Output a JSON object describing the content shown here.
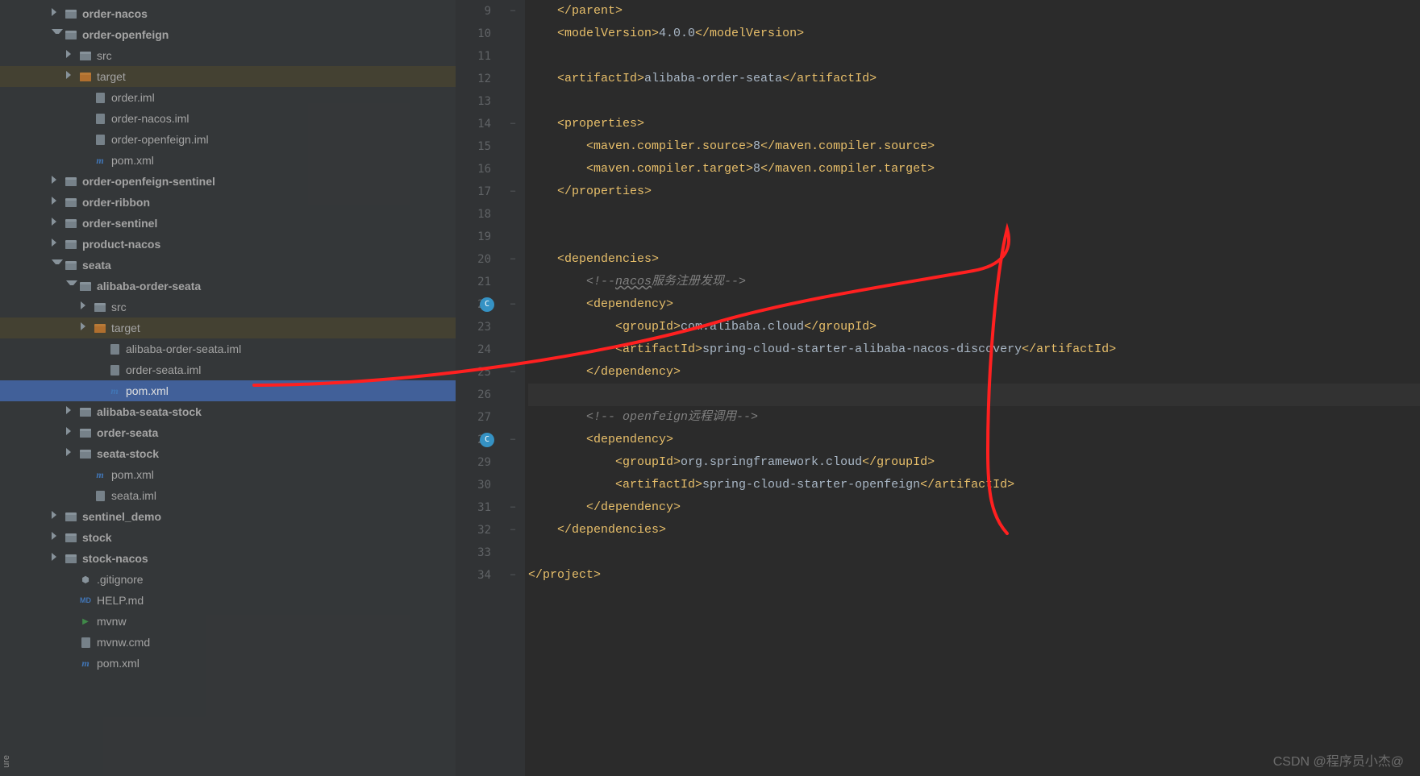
{
  "watermark": "CSDN @程序员小杰@",
  "sideLabel": "ure",
  "tree": [
    {
      "depth": 3,
      "arrow": "right",
      "icon": "folder",
      "label": "order-nacos",
      "bold": true
    },
    {
      "depth": 3,
      "arrow": "down",
      "icon": "folder",
      "label": "order-openfeign",
      "bold": true
    },
    {
      "depth": 4,
      "arrow": "right",
      "icon": "folder",
      "label": "src"
    },
    {
      "depth": 4,
      "arrow": "right",
      "icon": "folder-orange",
      "label": "target",
      "hl": true
    },
    {
      "depth": 5,
      "arrow": "none",
      "icon": "file",
      "label": "order.iml"
    },
    {
      "depth": 5,
      "arrow": "none",
      "icon": "file",
      "label": "order-nacos.iml"
    },
    {
      "depth": 5,
      "arrow": "none",
      "icon": "file",
      "label": "order-openfeign.iml"
    },
    {
      "depth": 5,
      "arrow": "none",
      "icon": "m",
      "label": "pom.xml"
    },
    {
      "depth": 3,
      "arrow": "right",
      "icon": "folder",
      "label": "order-openfeign-sentinel",
      "bold": true
    },
    {
      "depth": 3,
      "arrow": "right",
      "icon": "folder",
      "label": "order-ribbon",
      "bold": true
    },
    {
      "depth": 3,
      "arrow": "right",
      "icon": "folder",
      "label": "order-sentinel",
      "bold": true
    },
    {
      "depth": 3,
      "arrow": "right",
      "icon": "folder",
      "label": "product-nacos",
      "bold": true
    },
    {
      "depth": 3,
      "arrow": "down",
      "icon": "folder",
      "label": "seata",
      "bold": true
    },
    {
      "depth": 4,
      "arrow": "down",
      "icon": "folder",
      "label": "alibaba-order-seata",
      "bold": true
    },
    {
      "depth": 5,
      "arrow": "right",
      "icon": "folder",
      "label": "src"
    },
    {
      "depth": 5,
      "arrow": "right",
      "icon": "folder-orange",
      "label": "target",
      "hl": true
    },
    {
      "depth": 6,
      "arrow": "none",
      "icon": "file",
      "label": "alibaba-order-seata.iml"
    },
    {
      "depth": 6,
      "arrow": "none",
      "icon": "file",
      "label": "order-seata.iml"
    },
    {
      "depth": 6,
      "arrow": "none",
      "icon": "m",
      "label": "pom.xml",
      "sel": true
    },
    {
      "depth": 4,
      "arrow": "right",
      "icon": "folder",
      "label": "alibaba-seata-stock",
      "bold": true
    },
    {
      "depth": 4,
      "arrow": "right",
      "icon": "folder",
      "label": "order-seata",
      "bold": true
    },
    {
      "depth": 4,
      "arrow": "right",
      "icon": "folder",
      "label": "seata-stock",
      "bold": true
    },
    {
      "depth": 5,
      "arrow": "none",
      "icon": "m",
      "label": "pom.xml"
    },
    {
      "depth": 5,
      "arrow": "none",
      "icon": "file",
      "label": "seata.iml"
    },
    {
      "depth": 3,
      "arrow": "right",
      "icon": "folder",
      "label": "sentinel_demo",
      "bold": true
    },
    {
      "depth": 3,
      "arrow": "right",
      "icon": "folder",
      "label": "stock",
      "bold": true
    },
    {
      "depth": 3,
      "arrow": "right",
      "icon": "folder",
      "label": "stock-nacos",
      "bold": true
    },
    {
      "depth": 4,
      "arrow": "none",
      "icon": "git",
      "label": ".gitignore"
    },
    {
      "depth": 4,
      "arrow": "none",
      "icon": "md",
      "label": "HELP.md"
    },
    {
      "depth": 4,
      "arrow": "none",
      "icon": "play",
      "label": "mvnw"
    },
    {
      "depth": 4,
      "arrow": "none",
      "icon": "file",
      "label": "mvnw.cmd"
    },
    {
      "depth": 4,
      "arrow": "none",
      "icon": "m",
      "label": "pom.xml"
    }
  ],
  "lineNumbers": [
    "9",
    "10",
    "11",
    "12",
    "13",
    "14",
    "15",
    "16",
    "17",
    "18",
    "19",
    "20",
    "21",
    "22",
    "23",
    "24",
    "25",
    "26",
    "27",
    "28",
    "29",
    "30",
    "31",
    "32",
    "33",
    "34"
  ],
  "gutterMarks": {
    "22": "c",
    "28": "c"
  },
  "foldMarks": {
    "9": "⊖",
    "14": "⊖",
    "17": "⊖",
    "20": "⊖",
    "22": "⊖",
    "25": "⊖",
    "28": "⊖",
    "31": "⊖",
    "32": "⊖",
    "34": "⊖"
  },
  "code": {
    "9": [
      {
        "c": "t-tag",
        "t": "    </parent>"
      }
    ],
    "10": [
      {
        "c": "t-tag",
        "t": "    <modelVersion>"
      },
      {
        "c": "t-text",
        "t": "4.0.0"
      },
      {
        "c": "t-tag",
        "t": "</modelVersion>"
      }
    ],
    "11": [
      {
        "c": "",
        "t": ""
      }
    ],
    "12": [
      {
        "c": "t-tag",
        "t": "    <artifactId>"
      },
      {
        "c": "t-text",
        "t": "alibaba-order-seata"
      },
      {
        "c": "t-tag",
        "t": "</artifactId>"
      }
    ],
    "13": [
      {
        "c": "",
        "t": ""
      }
    ],
    "14": [
      {
        "c": "t-tag",
        "t": "    <properties>"
      }
    ],
    "15": [
      {
        "c": "t-tag",
        "t": "        <maven.compiler.source>"
      },
      {
        "c": "t-text",
        "t": "8"
      },
      {
        "c": "t-tag",
        "t": "</maven.compiler.source>"
      }
    ],
    "16": [
      {
        "c": "t-tag",
        "t": "        <maven.compiler.target>"
      },
      {
        "c": "t-text",
        "t": "8"
      },
      {
        "c": "t-tag",
        "t": "</maven.compiler.target>"
      }
    ],
    "17": [
      {
        "c": "t-tag",
        "t": "    </properties>"
      }
    ],
    "18": [
      {
        "c": "",
        "t": ""
      }
    ],
    "19": [
      {
        "c": "",
        "t": ""
      }
    ],
    "20": [
      {
        "c": "t-tag",
        "t": "    <dependencies>"
      }
    ],
    "21": [
      {
        "c": "t-comment",
        "t": "        <!--"
      },
      {
        "c": "t-comment-u",
        "t": "nacos"
      },
      {
        "c": "t-comment",
        "t": "服务注册发现-->"
      }
    ],
    "22": [
      {
        "c": "t-tag",
        "t": "        <dependency>"
      }
    ],
    "23": [
      {
        "c": "t-tag",
        "t": "            <groupId>"
      },
      {
        "c": "t-text",
        "t": "com.alibaba.cloud"
      },
      {
        "c": "t-tag",
        "t": "</groupId>"
      }
    ],
    "24": [
      {
        "c": "t-tag",
        "t": "            <artifactId>"
      },
      {
        "c": "t-text",
        "t": "spring-cloud-starter-alibaba-nacos-discovery"
      },
      {
        "c": "t-tag",
        "t": "</artifactId>"
      }
    ],
    "25": [
      {
        "c": "t-tag",
        "t": "        </dependency>"
      }
    ],
    "26": [
      {
        "c": "",
        "t": ""
      }
    ],
    "27": [
      {
        "c": "t-comment",
        "t": "        <!-- openfeign"
      },
      {
        "c": "t-comment",
        "t": "远程调用-->"
      }
    ],
    "28": [
      {
        "c": "t-tag",
        "t": "        <dependency>"
      }
    ],
    "29": [
      {
        "c": "t-tag",
        "t": "            <groupId>"
      },
      {
        "c": "t-text",
        "t": "org.springframework.cloud"
      },
      {
        "c": "t-tag",
        "t": "</groupId>"
      }
    ],
    "30": [
      {
        "c": "t-tag",
        "t": "            <artifactId>"
      },
      {
        "c": "t-text",
        "t": "spring-cloud-starter-openfeign"
      },
      {
        "c": "t-tag",
        "t": "</artifactId>"
      }
    ],
    "31": [
      {
        "c": "t-tag",
        "t": "        </dependency>"
      }
    ],
    "32": [
      {
        "c": "t-tag",
        "t": "    </dependencies>"
      }
    ],
    "33": [
      {
        "c": "",
        "t": ""
      }
    ],
    "34": [
      {
        "c": "t-tag",
        "t": "</project>"
      }
    ]
  }
}
